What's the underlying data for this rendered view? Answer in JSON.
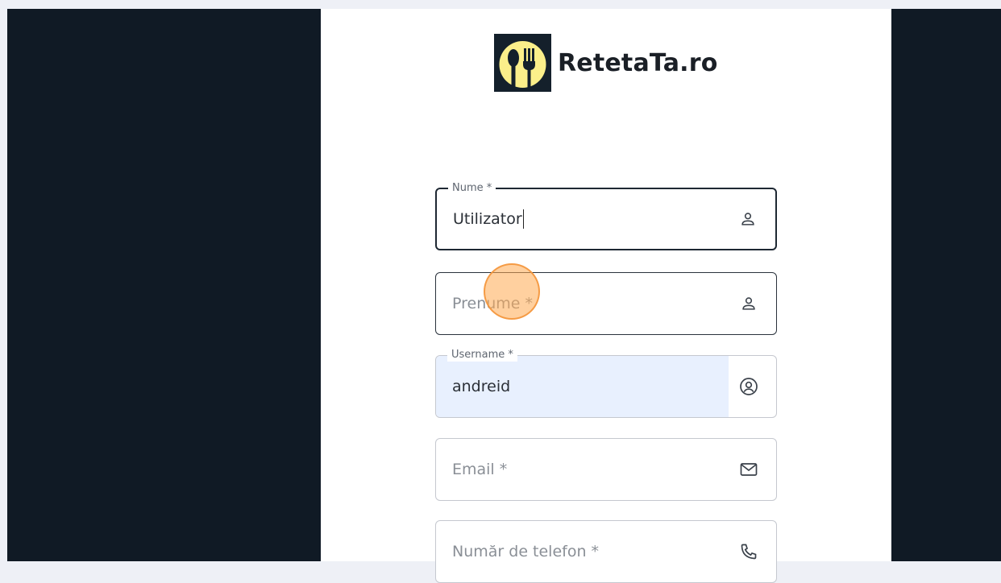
{
  "brand": {
    "name": "RetetaTa.ro",
    "logo_icon": "spoon-fork-icon",
    "colors": {
      "logo_bg": "#14202b",
      "logo_circle": "#fbef8a"
    }
  },
  "form": {
    "nume": {
      "label": "Nume *",
      "value": "Utilizator",
      "icon": "person-icon"
    },
    "prenume": {
      "placeholder": "Prenume *",
      "icon": "person-icon"
    },
    "username": {
      "label": "Username *",
      "value": "andreid",
      "icon": "account-circle-icon"
    },
    "email": {
      "placeholder": "Email *",
      "icon": "mail-icon"
    },
    "telefon": {
      "placeholder": "Număr de telefon *",
      "icon": "phone-icon"
    }
  },
  "colors": {
    "backdrop": "#101a25",
    "autofill": "#e8f0fe",
    "cursor_highlight": "#f7a65a"
  }
}
